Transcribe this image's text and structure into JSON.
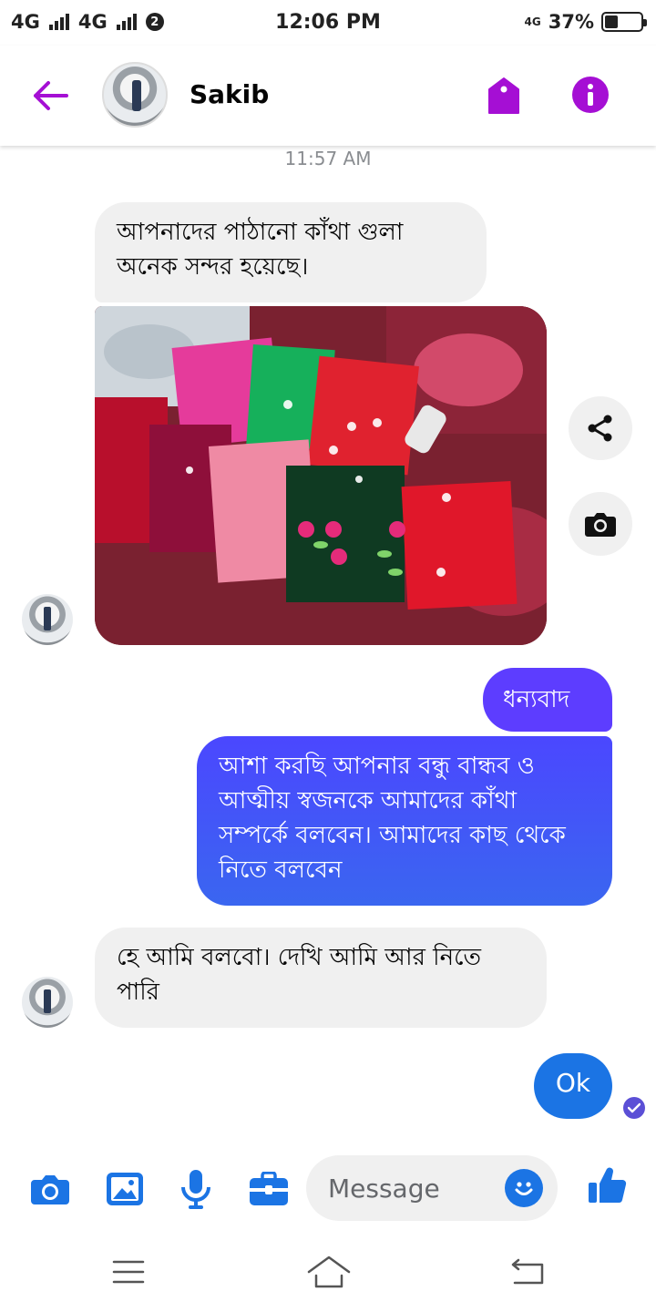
{
  "status_bar": {
    "carrier1": "4G",
    "carrier2": "4G",
    "notif_count": "2",
    "time": "12:06 PM",
    "network": "4G",
    "battery": "37%",
    "battery_level": 0.37
  },
  "header": {
    "contact_name": "Sakib",
    "accent_color": "#a50fd4"
  },
  "chat": {
    "timestamp": "11:57 AM",
    "messages": [
      {
        "direction": "in",
        "text": "আপনাদের পাঠানো কাঁথা গুলা অনেক সন্দর হয়েছে।"
      },
      {
        "direction": "in",
        "type": "photo"
      },
      {
        "direction": "out",
        "text": "ধন্যবাদ"
      },
      {
        "direction": "out",
        "text": "আশা করছি আপনার বন্ধু বান্ধব ও আত্মীয় স্বজনকে আমাদের কাঁথা সম্পর্কে বলবেন। আমাদের কাছ থেকে নিতে বলবেন"
      },
      {
        "direction": "in",
        "text": "হে আমি বলবো। দেখি আমি আর নিতে পারি"
      },
      {
        "direction": "out",
        "text": "Ok"
      }
    ]
  },
  "composer": {
    "placeholder": "Message",
    "icon_color": "#1b74e4"
  },
  "icons": [
    "back-arrow-icon",
    "tag-icon",
    "info-icon",
    "share-icon",
    "camera-icon",
    "gallery-icon",
    "microphone-icon",
    "briefcase-icon",
    "emoji-icon",
    "thumbs-up-icon",
    "menu-icon",
    "home-icon",
    "back-icon"
  ]
}
